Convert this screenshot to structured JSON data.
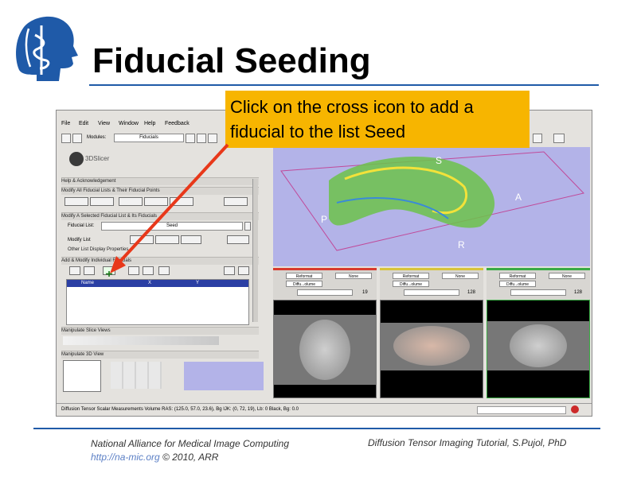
{
  "slide": {
    "title": "Fiducial Seeding",
    "callout": "Click on the cross icon to add a fiducial to the list Seed",
    "footer_left_line1": "National Alliance for Medical Image Computing",
    "footer_link": "http://na-mic.org",
    "footer_copyright": "© 2010, ARR",
    "footer_right": "Diffusion Tensor Imaging Tutorial, S.Pujol, PhD"
  },
  "app": {
    "menu": [
      "File",
      "Edit",
      "View",
      "Window",
      "Help",
      "Feedback"
    ],
    "modules_label": "Modules:",
    "module_value": "Fiducials",
    "logo_text": "3DSlicer",
    "sections": {
      "help": "Help & Acknowledgement",
      "modify_all": "Modify All Fiducial Lists & Their Fiducial Points",
      "modify_selected": "Modify A Selected Fiducial List & Its Fiducials",
      "other_props": "Other List Display Properties",
      "add_modify": "Add & Modify Individual Fiducials",
      "manip_slice": "Manipulate Slice Views",
      "manip_3d": "Manipulate 3D View"
    },
    "fiducial_list_label": "Fiducial List:",
    "fiducial_list_value": "Seed",
    "modify_list_label": "Modify List",
    "table_headers": [
      "Name",
      "X",
      "Y"
    ],
    "axes_3d": [
      "S",
      "A",
      "P",
      "R"
    ],
    "slice_views": [
      {
        "name": "Red",
        "color": "#d83a2e",
        "reformat": "Reformat",
        "none": "None",
        "volume": "Diffu...olume",
        "slice_no": "19"
      },
      {
        "name": "Yellow",
        "color": "#d8c43a",
        "reformat": "Reformat",
        "none": "None",
        "volume": "Diffu...olume",
        "slice_no": "128"
      },
      {
        "name": "Green",
        "color": "#3aaa44",
        "reformat": "Reformat",
        "none": "None",
        "volume": "Diffu...olume",
        "slice_no": "128"
      }
    ],
    "status": "Diffusion Tensor Scalar Measurements Volume RAS: (125.0, 57.0, 23.6), Bg IJK: (0, 72, 19), Lb: 0 Black, Bg: 0.0"
  },
  "colors": {
    "accent_blue": "#1f5aa8",
    "callout_bg": "#f7b500",
    "arrow": "#e8381a",
    "viewer_bg": "#b3b3e8"
  }
}
